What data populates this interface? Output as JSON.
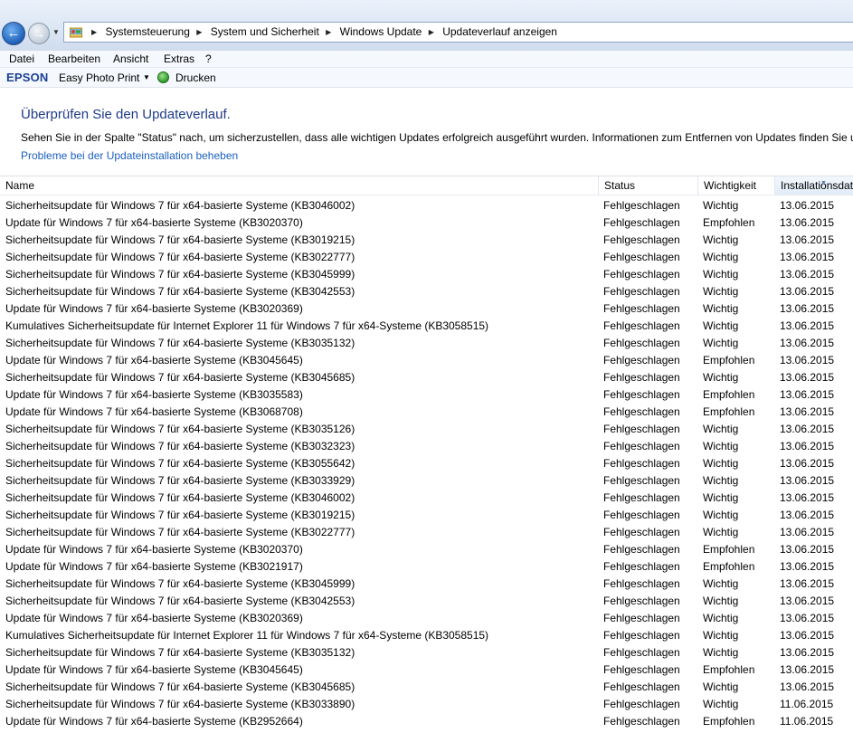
{
  "address_bar": {
    "breadcrumbs": [
      "Systemsteuerung",
      "System und Sicherheit",
      "Windows Update",
      "Updateverlauf anzeigen"
    ]
  },
  "menu": [
    "Datei",
    "Bearbeiten",
    "Ansicht",
    "Extras",
    "?"
  ],
  "toolbar": {
    "brand": "EPSON",
    "photo_print": "Easy Photo Print",
    "print": "Drucken"
  },
  "page": {
    "title": "Überprüfen Sie den Updateverlauf.",
    "description": "Sehen Sie in der Spalte \"Status\" nach, um sicherzustellen, dass alle wichtigen Updates erfolgreich ausgeführt wurden. Informationen zum Entfernen von Updates finden Sie unte",
    "help_link": "Probleme bei der Updateinstallation beheben"
  },
  "table": {
    "columns": [
      "Name",
      "Status",
      "Wichtigkeit",
      "Installationsdat"
    ],
    "rows": [
      [
        "Sicherheitsupdate für Windows 7 für x64-basierte Systeme (KB3046002)",
        "Fehlgeschlagen",
        "Wichtig",
        "13.06.2015"
      ],
      [
        "Update für Windows 7 für x64-basierte Systeme (KB3020370)",
        "Fehlgeschlagen",
        "Empfohlen",
        "13.06.2015"
      ],
      [
        "Sicherheitsupdate für Windows 7 für x64-basierte Systeme (KB3019215)",
        "Fehlgeschlagen",
        "Wichtig",
        "13.06.2015"
      ],
      [
        "Sicherheitsupdate für Windows 7 für x64-basierte Systeme (KB3022777)",
        "Fehlgeschlagen",
        "Wichtig",
        "13.06.2015"
      ],
      [
        "Sicherheitsupdate für Windows 7 für x64-basierte Systeme (KB3045999)",
        "Fehlgeschlagen",
        "Wichtig",
        "13.06.2015"
      ],
      [
        "Sicherheitsupdate für Windows 7 für x64-basierte Systeme (KB3042553)",
        "Fehlgeschlagen",
        "Wichtig",
        "13.06.2015"
      ],
      [
        "Update für Windows 7 für x64-basierte Systeme (KB3020369)",
        "Fehlgeschlagen",
        "Wichtig",
        "13.06.2015"
      ],
      [
        "Kumulatives Sicherheitsupdate für Internet Explorer 11 für Windows 7 für x64-Systeme (KB3058515)",
        "Fehlgeschlagen",
        "Wichtig",
        "13.06.2015"
      ],
      [
        "Sicherheitsupdate für Windows 7 für x64-basierte Systeme (KB3035132)",
        "Fehlgeschlagen",
        "Wichtig",
        "13.06.2015"
      ],
      [
        "Update für Windows 7 für x64-basierte Systeme (KB3045645)",
        "Fehlgeschlagen",
        "Empfohlen",
        "13.06.2015"
      ],
      [
        "Sicherheitsupdate für Windows 7 für x64-basierte Systeme (KB3045685)",
        "Fehlgeschlagen",
        "Wichtig",
        "13.06.2015"
      ],
      [
        "Update für Windows 7 für x64-basierte Systeme (KB3035583)",
        "Fehlgeschlagen",
        "Empfohlen",
        "13.06.2015"
      ],
      [
        "Update für Windows 7 für x64-basierte Systeme (KB3068708)",
        "Fehlgeschlagen",
        "Empfohlen",
        "13.06.2015"
      ],
      [
        "Sicherheitsupdate für Windows 7 für x64-basierte Systeme (KB3035126)",
        "Fehlgeschlagen",
        "Wichtig",
        "13.06.2015"
      ],
      [
        "Sicherheitsupdate für Windows 7 für x64-basierte Systeme (KB3032323)",
        "Fehlgeschlagen",
        "Wichtig",
        "13.06.2015"
      ],
      [
        "Sicherheitsupdate für Windows 7 für x64-basierte Systeme (KB3055642)",
        "Fehlgeschlagen",
        "Wichtig",
        "13.06.2015"
      ],
      [
        "Sicherheitsupdate für Windows 7 für x64-basierte Systeme (KB3033929)",
        "Fehlgeschlagen",
        "Wichtig",
        "13.06.2015"
      ],
      [
        "Sicherheitsupdate für Windows 7 für x64-basierte Systeme (KB3046002)",
        "Fehlgeschlagen",
        "Wichtig",
        "13.06.2015"
      ],
      [
        "Sicherheitsupdate für Windows 7 für x64-basierte Systeme (KB3019215)",
        "Fehlgeschlagen",
        "Wichtig",
        "13.06.2015"
      ],
      [
        "Sicherheitsupdate für Windows 7 für x64-basierte Systeme (KB3022777)",
        "Fehlgeschlagen",
        "Wichtig",
        "13.06.2015"
      ],
      [
        "Update für Windows 7 für x64-basierte Systeme (KB3020370)",
        "Fehlgeschlagen",
        "Empfohlen",
        "13.06.2015"
      ],
      [
        "Update für Windows 7 für x64-basierte Systeme (KB3021917)",
        "Fehlgeschlagen",
        "Empfohlen",
        "13.06.2015"
      ],
      [
        "Sicherheitsupdate für Windows 7 für x64-basierte Systeme (KB3045999)",
        "Fehlgeschlagen",
        "Wichtig",
        "13.06.2015"
      ],
      [
        "Sicherheitsupdate für Windows 7 für x64-basierte Systeme (KB3042553)",
        "Fehlgeschlagen",
        "Wichtig",
        "13.06.2015"
      ],
      [
        "Update für Windows 7 für x64-basierte Systeme (KB3020369)",
        "Fehlgeschlagen",
        "Wichtig",
        "13.06.2015"
      ],
      [
        "Kumulatives Sicherheitsupdate für Internet Explorer 11 für Windows 7 für x64-Systeme (KB3058515)",
        "Fehlgeschlagen",
        "Wichtig",
        "13.06.2015"
      ],
      [
        "Sicherheitsupdate für Windows 7 für x64-basierte Systeme (KB3035132)",
        "Fehlgeschlagen",
        "Wichtig",
        "13.06.2015"
      ],
      [
        "Update für Windows 7 für x64-basierte Systeme (KB3045645)",
        "Fehlgeschlagen",
        "Empfohlen",
        "13.06.2015"
      ],
      [
        "Sicherheitsupdate für Windows 7 für x64-basierte Systeme (KB3045685)",
        "Fehlgeschlagen",
        "Wichtig",
        "13.06.2015"
      ],
      [
        "Sicherheitsupdate für Windows 7 für x64-basierte Systeme (KB3033890)",
        "Fehlgeschlagen",
        "Wichtig",
        "11.06.2015"
      ],
      [
        "Update für Windows 7 für x64-basierte Systeme (KB2952664)",
        "Fehlgeschlagen",
        "Empfohlen",
        "11.06.2015"
      ]
    ]
  }
}
